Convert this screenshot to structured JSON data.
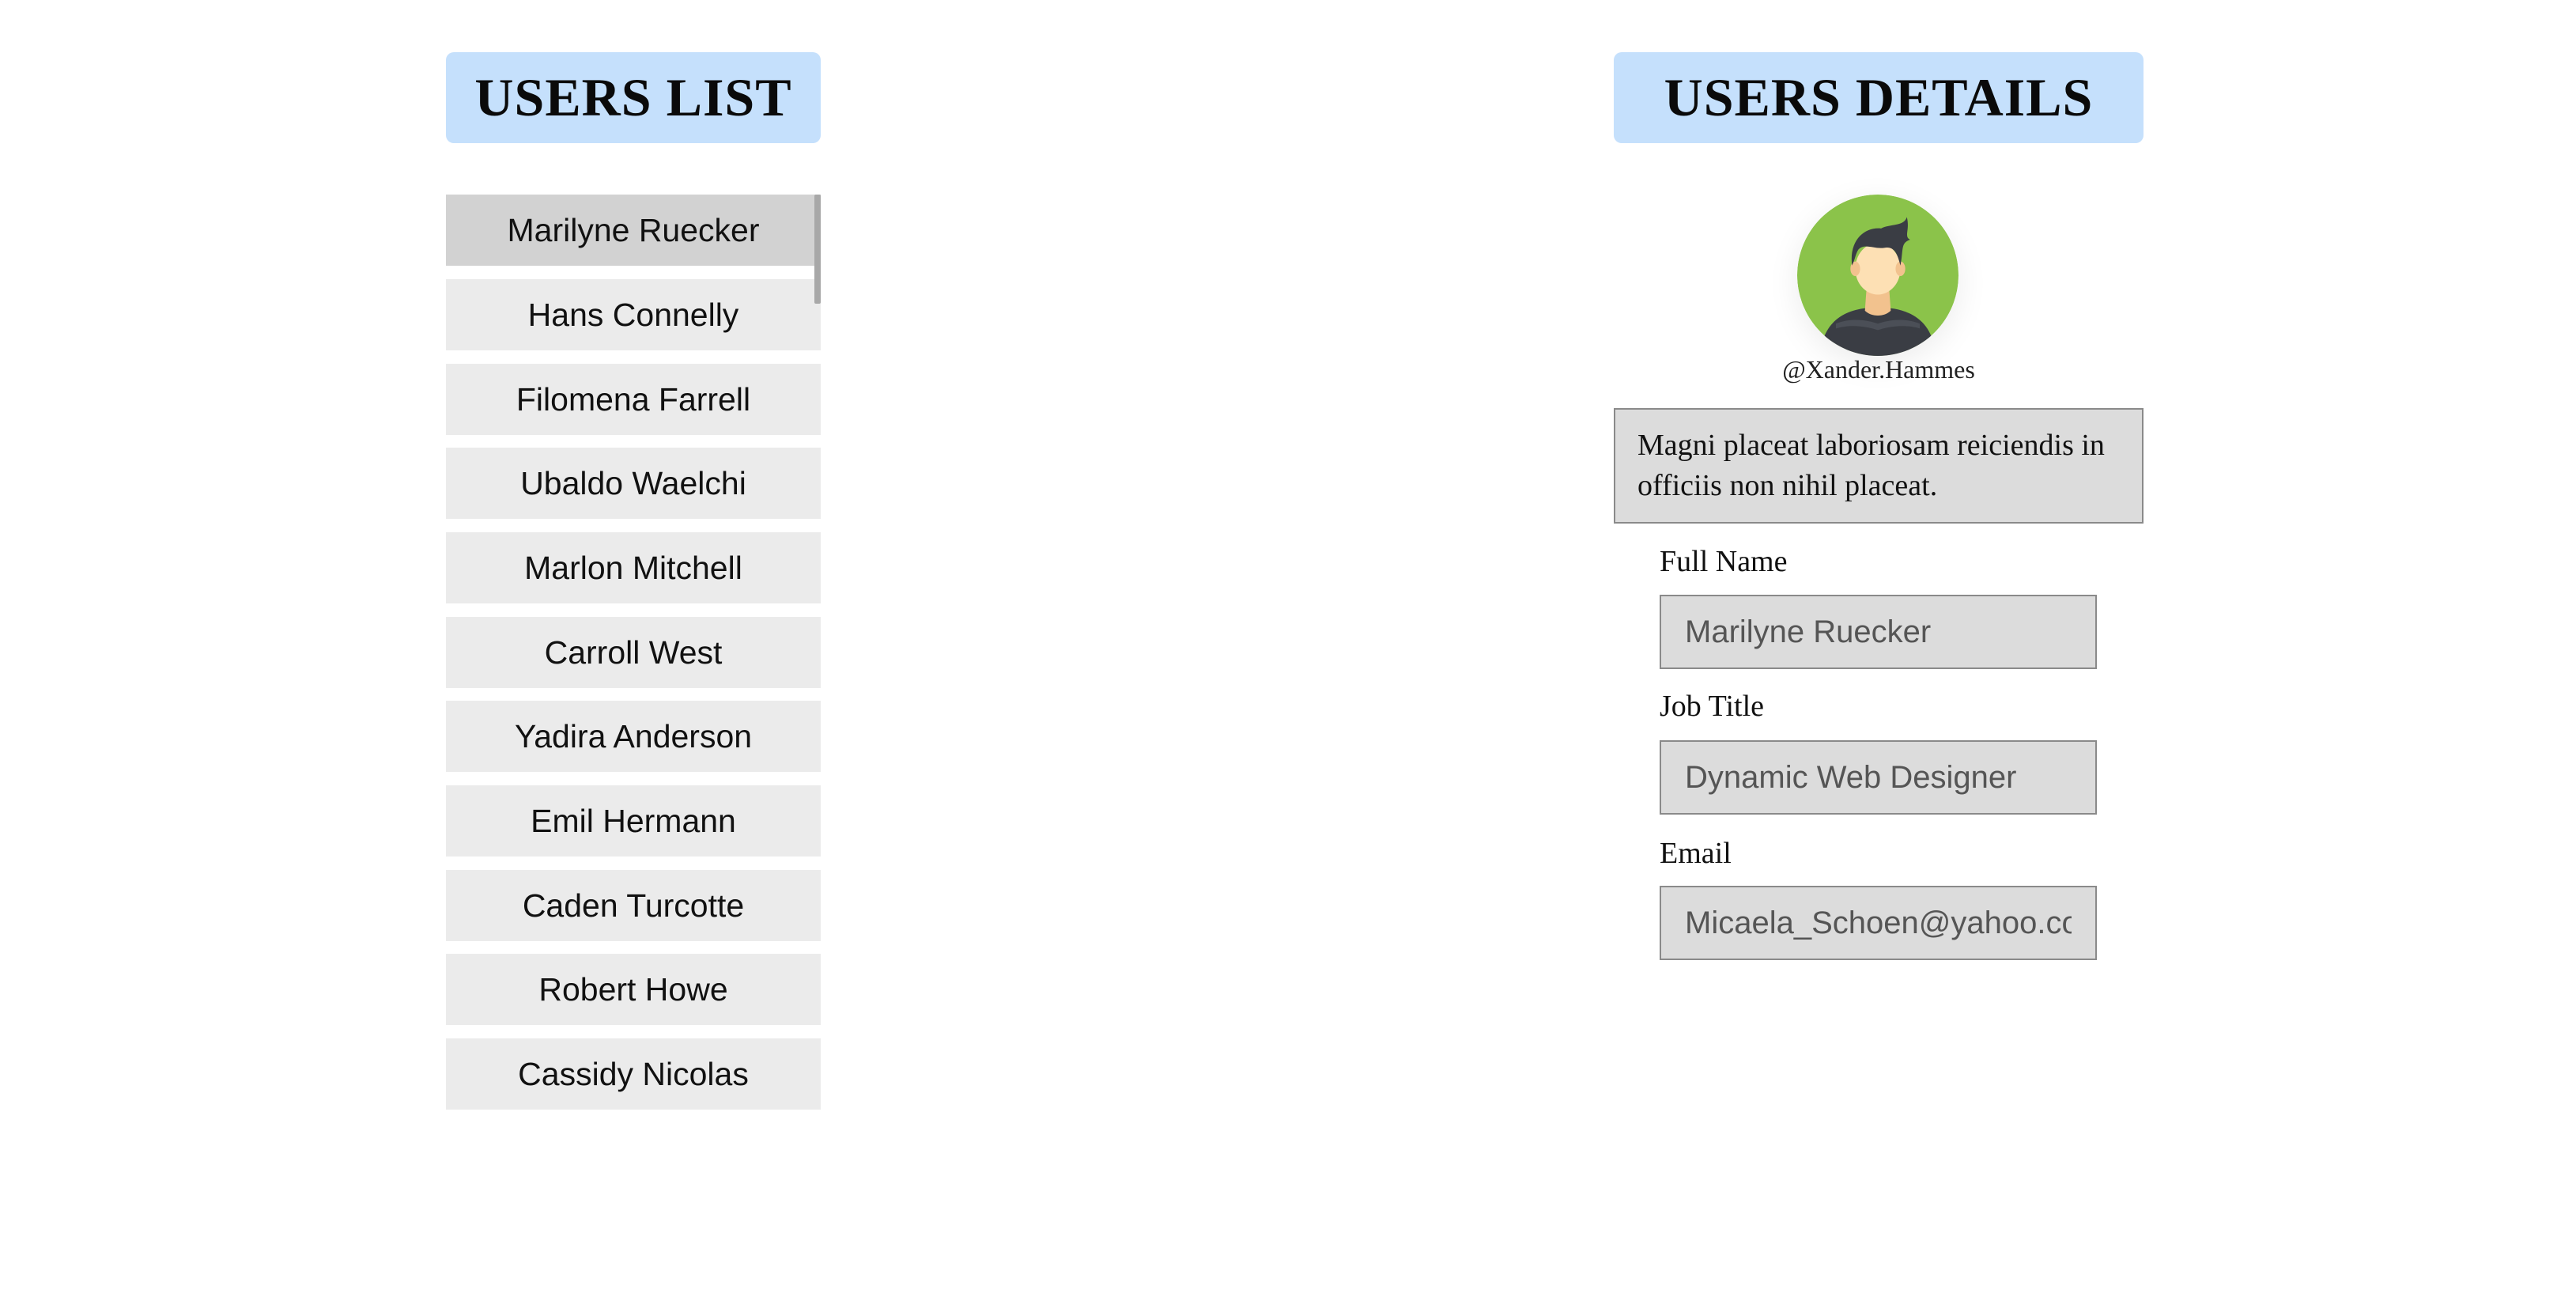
{
  "users_list": {
    "heading": "USERS LIST",
    "items": [
      {
        "label": "Marilyne Ruecker",
        "selected": true
      },
      {
        "label": "Hans Connelly",
        "selected": false
      },
      {
        "label": "Filomena Farrell",
        "selected": false
      },
      {
        "label": "Ubaldo Waelchi",
        "selected": false
      },
      {
        "label": "Marlon Mitchell",
        "selected": false
      },
      {
        "label": "Carroll West",
        "selected": false
      },
      {
        "label": "Yadira Anderson",
        "selected": false
      },
      {
        "label": "Emil Hermann",
        "selected": false
      },
      {
        "label": "Caden Turcotte",
        "selected": false
      },
      {
        "label": "Robert Howe",
        "selected": false
      },
      {
        "label": "Cassidy Nicolas",
        "selected": false
      }
    ]
  },
  "users_details": {
    "heading": "USERS DETAILS",
    "avatar_icon": "avatar-icon",
    "username": "@Xander.Hammes",
    "bio": "Magni placeat laboriosam reiciendis in officiis non nihil placeat.",
    "fields": {
      "full_name": {
        "label": "Full Name",
        "value": "Marilyne Ruecker"
      },
      "job_title": {
        "label": "Job Title",
        "value": "Dynamic Web Designer"
      },
      "email": {
        "label": "Email",
        "value": "Micaela_Schoen@yahoo.com"
      }
    }
  },
  "colors": {
    "heading_bg": "#c5e0fc",
    "list_item_bg": "#ebebeb",
    "list_item_selected_bg": "#d2d2d2",
    "field_bg": "#dcdcdc",
    "avatar_bg": "#8bc34a"
  }
}
